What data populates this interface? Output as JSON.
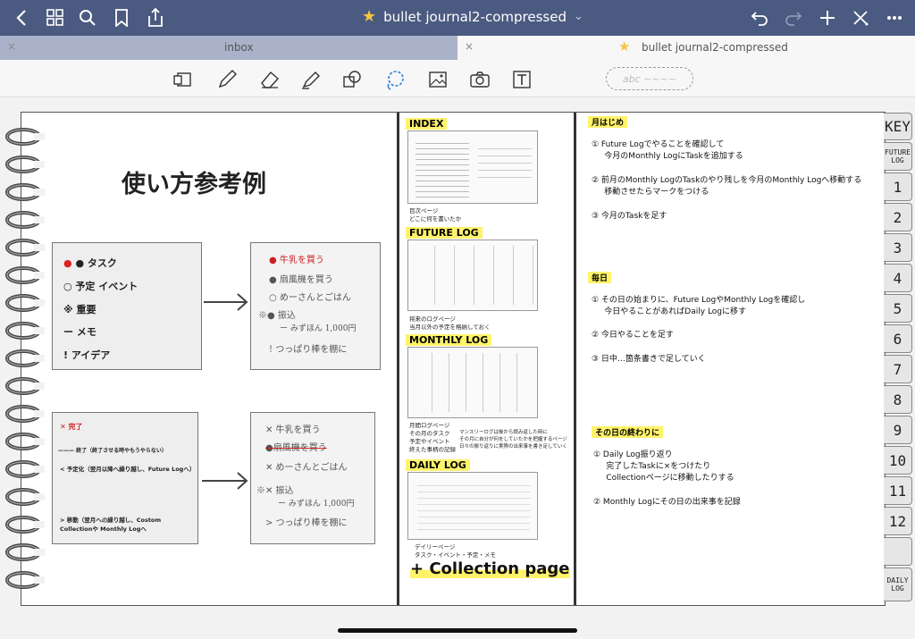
{
  "app": {
    "title": "bullet journal2-compressed",
    "star": "★",
    "caret": "⌄"
  },
  "tabs": [
    {
      "label": "inbox",
      "close": "×"
    },
    {
      "label": "bullet journal2-compressed",
      "close": "×"
    }
  ],
  "toolbar": {
    "lasso_hint": "abc ~~~~"
  },
  "page": {
    "main_title": "使い方参考例",
    "legend1": [
      "● タスク",
      "○ 予定 イベント",
      "※ 重要",
      "ー メモ",
      "! アイデア"
    ],
    "example1": [
      "● 牛乳を買う",
      "● 扇風機を買う",
      "○ めーさんとごはん",
      "※● 振込",
      "ー みずほん 1,000円",
      "! つっぱり棒を棚に"
    ],
    "legend2": [
      "✕   完了",
      "———   終了（終了させる時やもうやらない）",
      "<  予定化（翌月以降へ繰り越し、Future Logへ）",
      "> 移動（翌月への繰り越し、Costom Collectionや Monthly Logへ"
    ],
    "example2": [
      "✕ 牛乳を買う",
      "●扇風機を買う",
      "✕ めーさんとごはん",
      "※✕ 振込",
      "ー みずほん 1,000円",
      "> つっぱり棒を棚に"
    ],
    "sections": {
      "index": "INDEX",
      "index_caption": "目次ページ\nどこに何を書いたか",
      "future": "FUTURE LOG",
      "future_caption": "将来のログページ\n当月以外の予定を格納しておく",
      "monthly": "MONTHLY LOG",
      "monthly_caption": "月間ログページ\nその月のタスク\n予定やイベント\n終えた事柄の記録",
      "monthly_note": "マンスリーログは後から読み返した時に\nその月に自分が何をしていたかを把握するページ\n日々の振り返りに実際の出来事を書き足していく",
      "daily": "DAILY LOG",
      "daily_caption": "デイリーページ\nタスク・イベント・予定・メモ",
      "collection": "+ Collection page"
    },
    "right": {
      "h1": "月はじめ",
      "h1_items": [
        "① Future Logでやることを確認して\n     今月のMonthly LogにTaskを追加する",
        "② 前月のMonthly LogのTaskのやり残しを今月のMonthly Logへ移動する\n     移動させたらマークをつける",
        "③ 今月のTaskを足す"
      ],
      "h2": "毎日",
      "h2_items": [
        "① その日の始まりに、Future LogやMonthly Logを確認し\n     今日やることがあればDaily Logに移す",
        "② 今日やることを足す",
        "③ 日中…箇条書きで足していく"
      ],
      "h3": "その日の終わりに",
      "h3_items": [
        "① Daily Log振り返り\n     完了したTaskに×をつけたり\n     Collectionページに移動したりする",
        "② Monthly Logにその日の出来事を記録"
      ]
    },
    "side_tabs": [
      "KEY",
      "FUTURE LOG",
      "1",
      "2",
      "3",
      "4",
      "5",
      "6",
      "7",
      "8",
      "9",
      "10",
      "11",
      "12",
      "",
      "DAILY LOG"
    ]
  }
}
